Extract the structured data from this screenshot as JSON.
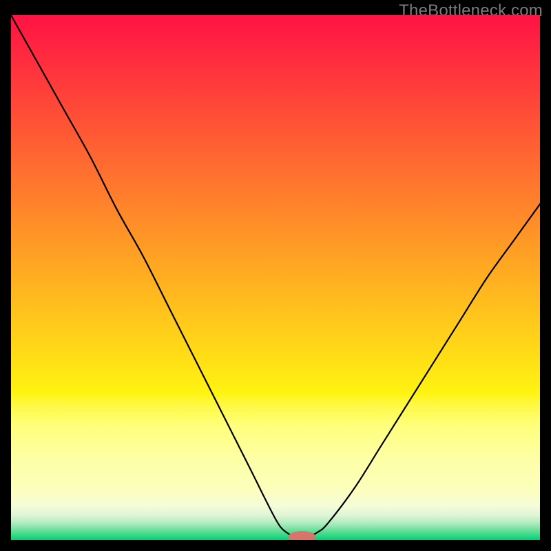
{
  "watermark": "TheBottleneck.com",
  "colors": {
    "background": "#000000",
    "curve": "#000000",
    "marker_fill": "#d8746a",
    "gradient_stops": [
      {
        "offset": 0.0,
        "color": "#ff1244"
      },
      {
        "offset": 0.08,
        "color": "#ff2b3f"
      },
      {
        "offset": 0.16,
        "color": "#ff4439"
      },
      {
        "offset": 0.24,
        "color": "#ff5d33"
      },
      {
        "offset": 0.32,
        "color": "#ff762e"
      },
      {
        "offset": 0.4,
        "color": "#ff8f28"
      },
      {
        "offset": 0.48,
        "color": "#ffa822"
      },
      {
        "offset": 0.56,
        "color": "#ffc11d"
      },
      {
        "offset": 0.64,
        "color": "#ffda17"
      },
      {
        "offset": 0.72,
        "color": "#fff311"
      },
      {
        "offset": 0.74,
        "color": "#fff83e"
      },
      {
        "offset": 0.78,
        "color": "#ffff7a"
      },
      {
        "offset": 0.84,
        "color": "#fdffa3"
      },
      {
        "offset": 0.905,
        "color": "#fcffbd"
      },
      {
        "offset": 0.935,
        "color": "#f5fcd8"
      },
      {
        "offset": 0.953,
        "color": "#dff5d6"
      },
      {
        "offset": 0.967,
        "color": "#b3ecc0"
      },
      {
        "offset": 0.985,
        "color": "#55dd92"
      },
      {
        "offset": 1.0,
        "color": "#00d178"
      }
    ]
  },
  "chart_data": {
    "type": "line",
    "title": "",
    "xlabel": "",
    "ylabel": "",
    "xlim": [
      0,
      100
    ],
    "ylim": [
      0,
      100
    ],
    "grid": false,
    "legend": false,
    "annotations": [],
    "series": [
      {
        "name": "bottleneck-curve",
        "x": [
          0,
          5,
          10,
          15,
          20,
          25,
          30,
          35,
          40,
          45,
          50,
          52,
          54,
          56,
          58,
          60,
          65,
          70,
          75,
          80,
          85,
          90,
          95,
          100
        ],
        "values": [
          100,
          91,
          82,
          73,
          63,
          54,
          44,
          34,
          24,
          14,
          4,
          1.5,
          0.6,
          0.6,
          1.5,
          3.3,
          10,
          18,
          26,
          34,
          42,
          50,
          57,
          64
        ]
      }
    ],
    "marker": {
      "x": 55,
      "y": 0.6,
      "rx": 2.6,
      "ry": 1.1
    }
  }
}
